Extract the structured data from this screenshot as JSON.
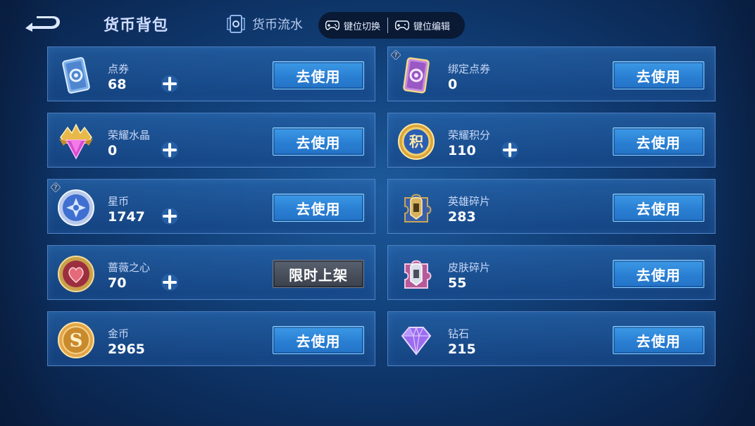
{
  "header": {
    "title": "货币背包",
    "flow_label": "货币流水",
    "key_switch": "键位切换",
    "key_edit": "键位编辑"
  },
  "colors": {
    "accent": "#2a7fd3",
    "card_border": "#78aaeb",
    "limited": "#464d59"
  },
  "currencies": [
    {
      "name": "点券",
      "value": "68",
      "action": "去使用",
      "icon": "coupon-card-icon",
      "has_plus": true
    },
    {
      "name": "绑定点券",
      "value": "0",
      "action": "去使用",
      "icon": "bound-coupon-card-icon",
      "has_plus": false,
      "has_help": true
    },
    {
      "name": "荣耀水晶",
      "value": "0",
      "action": "去使用",
      "icon": "glory-crystal-icon",
      "has_plus": true
    },
    {
      "name": "荣耀积分",
      "value": "110",
      "action": "去使用",
      "icon": "glory-points-icon",
      "has_plus": true
    },
    {
      "name": "星币",
      "value": "1747",
      "action": "去使用",
      "icon": "star-coin-icon",
      "has_plus": true,
      "has_help": true
    },
    {
      "name": "英雄碎片",
      "value": "283",
      "action": "去使用",
      "icon": "hero-fragment-icon",
      "has_plus": false
    },
    {
      "name": "蔷薇之心",
      "value": "70",
      "action": "限时上架",
      "icon": "rose-heart-icon",
      "has_plus": true,
      "limited": true
    },
    {
      "name": "皮肤碎片",
      "value": "55",
      "action": "去使用",
      "icon": "skin-fragment-icon",
      "has_plus": false
    },
    {
      "name": "金币",
      "value": "2965",
      "action": "去使用",
      "icon": "gold-coin-icon",
      "has_plus": false
    },
    {
      "name": "钻石",
      "value": "215",
      "action": "去使用",
      "icon": "diamond-icon",
      "has_plus": false
    }
  ]
}
